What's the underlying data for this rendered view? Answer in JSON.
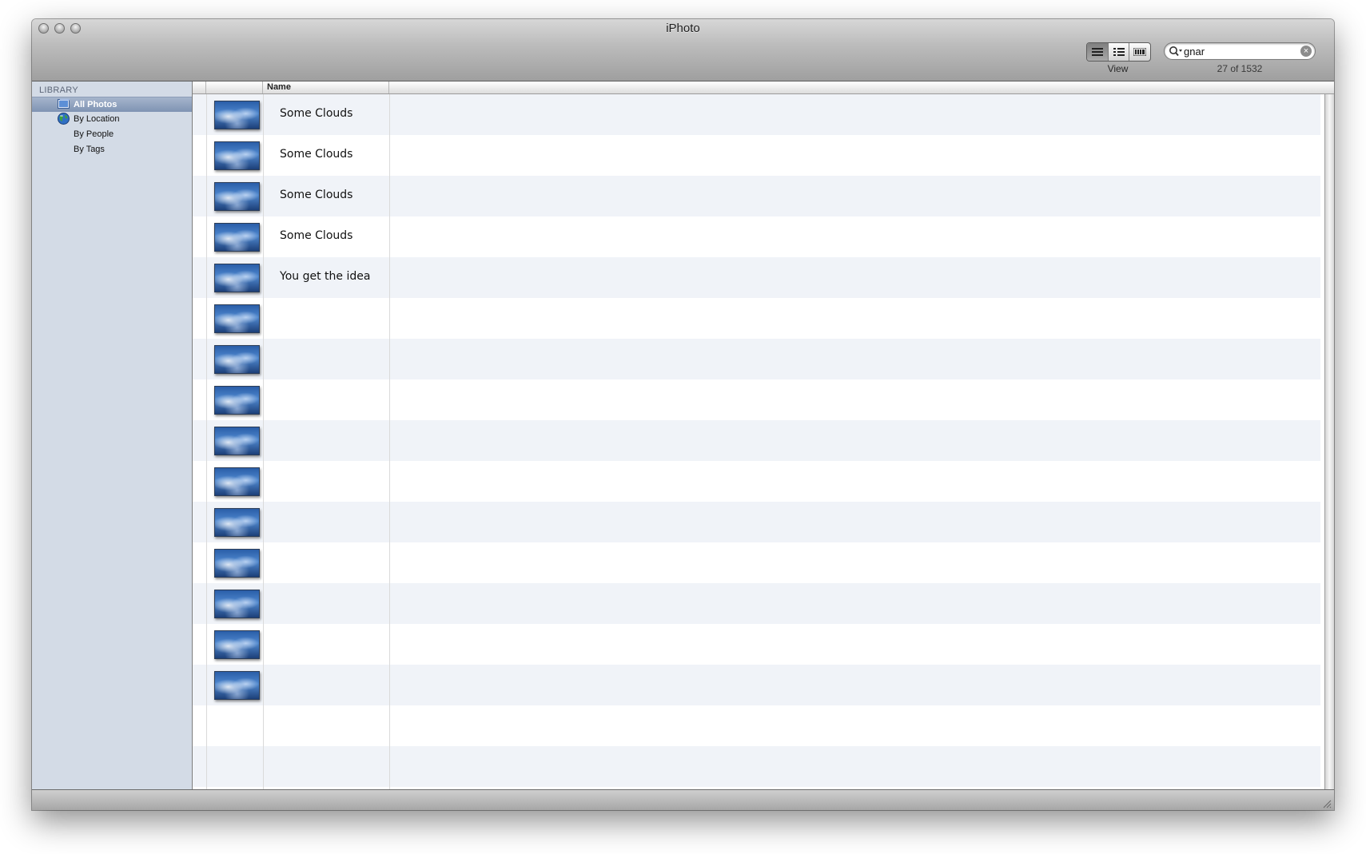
{
  "window": {
    "title": "iPhoto"
  },
  "toolbar": {
    "view_label": "View",
    "view_modes": [
      "list-view-icon",
      "detail-view-icon",
      "filmstrip-view-icon"
    ],
    "active_view": 0,
    "search": {
      "value": "gnar",
      "placeholder": ""
    },
    "result_count": "27 of 1532"
  },
  "sidebar": {
    "heading": "LIBRARY",
    "items": [
      {
        "label": "All Photos",
        "icon": "photos-icon",
        "selected": true
      },
      {
        "label": "By Location",
        "icon": "globe-icon",
        "selected": false
      },
      {
        "label": "By People",
        "icon": "",
        "selected": false
      },
      {
        "label": "By Tags",
        "icon": "",
        "selected": false
      }
    ]
  },
  "table": {
    "columns": [
      "",
      "Name"
    ],
    "rows": [
      {
        "name": "Some Clouds",
        "has_thumb": true
      },
      {
        "name": "Some Clouds",
        "has_thumb": true
      },
      {
        "name": "Some Clouds",
        "has_thumb": true
      },
      {
        "name": "Some Clouds",
        "has_thumb": true
      },
      {
        "name": "You get the idea",
        "has_thumb": true
      },
      {
        "name": "",
        "has_thumb": true
      },
      {
        "name": "",
        "has_thumb": true
      },
      {
        "name": "",
        "has_thumb": true
      },
      {
        "name": "",
        "has_thumb": true
      },
      {
        "name": "",
        "has_thumb": true
      },
      {
        "name": "",
        "has_thumb": true
      },
      {
        "name": "",
        "has_thumb": true
      },
      {
        "name": "",
        "has_thumb": true
      },
      {
        "name": "",
        "has_thumb": true
      },
      {
        "name": "",
        "has_thumb": true
      },
      {
        "name": "",
        "has_thumb": false
      },
      {
        "name": "",
        "has_thumb": false
      }
    ]
  },
  "colors": {
    "sidebar_bg": "#d3dbe6",
    "selection": "#7f93b3",
    "row_alt": "#f0f3f8"
  }
}
